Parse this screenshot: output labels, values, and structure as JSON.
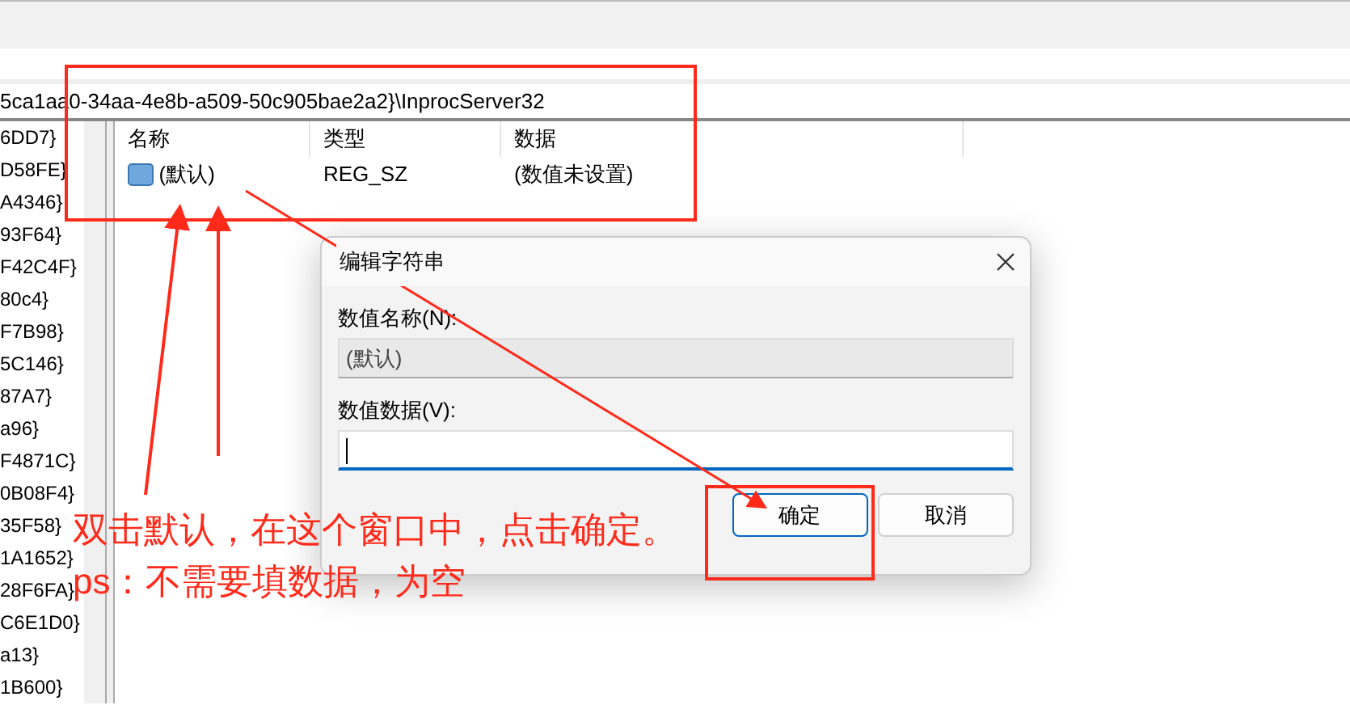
{
  "address": "5ca1aa0-34aa-4e8b-a509-50c905bae2a2}\\InprocServer32",
  "tree": {
    "items": [
      "6DD7}",
      "D58FE}",
      "A4346}",
      "93F64}",
      "F42C4F}",
      "80c4}",
      "F7B98}",
      "5C146}",
      "87A7}",
      "a96}",
      "F4871C}",
      "0B08F4}",
      "35F58}",
      "1A1652}",
      "28F6FA}",
      "C6E1D0}",
      "a13}",
      "1B600}"
    ]
  },
  "list": {
    "columns": [
      "名称",
      "类型",
      "数据"
    ],
    "rows": [
      {
        "name": "(默认)",
        "type": "REG_SZ",
        "data": "(数值未设置)",
        "selected": false
      }
    ]
  },
  "dialog": {
    "title": "编辑字符串",
    "fields": [
      {
        "label": "数值名称(N):",
        "value": "(默认)",
        "disabled": true,
        "focused": false
      },
      {
        "label": "数值数据(V):",
        "disabled": false,
        "focused": true
      }
    ],
    "buttons": [
      {
        "label": "确定",
        "default": true
      },
      {
        "label": "取消",
        "default": false
      }
    ]
  },
  "annotations": {
    "texts": [
      "双击默认，在这个窗口中，点击确定。",
      "ps：不需要填数据，为空"
    ]
  }
}
